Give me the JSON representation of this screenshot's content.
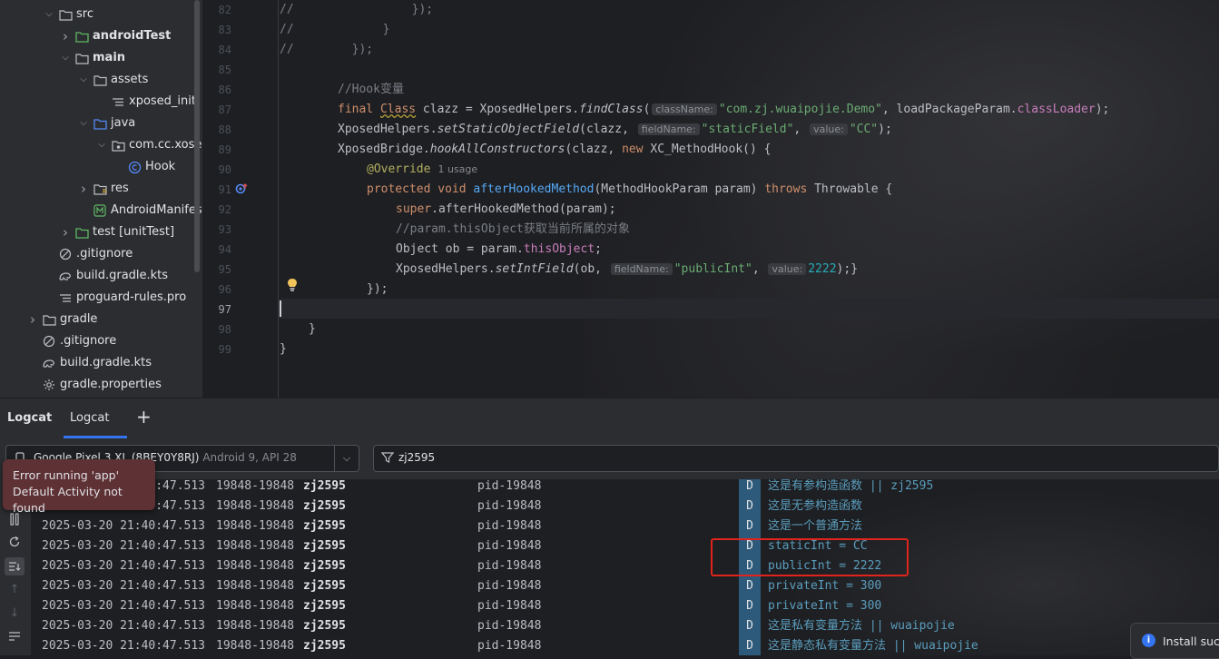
{
  "project_tree": {
    "items": [
      {
        "label": "src",
        "icon": "folder-icon",
        "indent": 1,
        "chevron": "v",
        "bold": false
      },
      {
        "label": "androidTest",
        "icon": "test-folder-icon",
        "indent": 2,
        "chevron": ">",
        "bold": true
      },
      {
        "label": "main",
        "icon": "folder-icon",
        "indent": 2,
        "chevron": "v",
        "bold": true
      },
      {
        "label": "assets",
        "icon": "folder-icon",
        "indent": 3,
        "chevron": "v",
        "bold": false
      },
      {
        "label": "xposed_init",
        "icon": "text-file-icon",
        "indent": 4,
        "chevron": "",
        "bold": false
      },
      {
        "label": "java",
        "icon": "source-folder-icon",
        "indent": 3,
        "chevron": "v",
        "bold": false
      },
      {
        "label": "com.cc.xosed",
        "icon": "package-icon",
        "indent": 4,
        "chevron": "v",
        "bold": false
      },
      {
        "label": "Hook",
        "icon": "class-icon",
        "indent": 5,
        "chevron": "",
        "bold": false
      },
      {
        "label": "res",
        "icon": "resource-folder-icon",
        "indent": 3,
        "chevron": ">",
        "bold": false
      },
      {
        "label": "AndroidManifest",
        "icon": "manifest-icon",
        "indent": 3,
        "chevron": "",
        "bold": false
      },
      {
        "label": "test [unitTest]",
        "icon": "test-folder-icon",
        "indent": 2,
        "chevron": ">",
        "bold": false
      },
      {
        "label": ".gitignore",
        "icon": "gitignore-icon",
        "indent": 1,
        "chevron": "",
        "bold": false
      },
      {
        "label": "build.gradle.kts",
        "icon": "gradle-icon",
        "indent": 1,
        "chevron": "",
        "bold": false
      },
      {
        "label": "proguard-rules.pro",
        "icon": "text-file-icon",
        "indent": 1,
        "chevron": "",
        "bold": false
      },
      {
        "label": "gradle",
        "icon": "folder-icon",
        "indent": 0,
        "chevron": ">",
        "bold": false
      },
      {
        "label": ".gitignore",
        "icon": "gitignore-icon",
        "indent": 0,
        "chevron": "",
        "bold": false
      },
      {
        "label": "build.gradle.kts",
        "icon": "gradle-icon",
        "indent": 0,
        "chevron": "",
        "bold": false
      },
      {
        "label": "gradle.properties",
        "icon": "settings-icon",
        "indent": 0,
        "chevron": "",
        "bold": false
      }
    ]
  },
  "editor": {
    "line_numbers": [
      "82",
      "83",
      "84",
      "85",
      "86",
      "87",
      "88",
      "89",
      "90",
      "91",
      "92",
      "93",
      "94",
      "95",
      "96",
      "97",
      "98",
      "99"
    ],
    "code": {
      "l82": [
        "//",
        "});"
      ],
      "l83": [
        "//",
        "}"
      ],
      "l84": [
        "//",
        "});"
      ],
      "l86": "//Hook变量",
      "l87": {
        "kw": "final ",
        "type": "Class",
        "rest1": " clazz = XposedHelpers.",
        "call": "findClass",
        "hint1": "className:",
        "s1": "\"com.zj.wuaipojie.Demo\"",
        "rest2": ", loadPackageParam.",
        "fld": "classLoader",
        "end": ");"
      },
      "l88": {
        "pre": "XposedHelpers.",
        "call": "setStaticObjectField",
        "rest1": "(clazz, ",
        "hint1": "fieldName:",
        "s1": "\"staticField\"",
        "sep": ", ",
        "hint2": "value:",
        "s2": "\"CC\"",
        "end": ");"
      },
      "l89": {
        "pre": "XposedBridge.",
        "call": "hookAllConstructors",
        "rest1": "(clazz, ",
        "kw": "new",
        "rest2": " XC_MethodHook() {"
      },
      "l90": {
        "ann": "@Override",
        "usage": "1 usage"
      },
      "l91": {
        "kw": "protected void ",
        "fn": "afterHookedMethod",
        "rest1": "(MethodHookParam param) ",
        "kw2": "throws",
        "rest2": " Throwable {"
      },
      "l92": {
        "kw": "super",
        "rest": ".afterHookedMethod(param);"
      },
      "l93": "//param.thisObject获取当前所属的对象",
      "l94": {
        "pre": "Object ob = param.",
        "fld": "thisObject",
        "end": ";"
      },
      "l95": {
        "pre": "XposedHelpers.",
        "call": "setIntField",
        "rest1": "(ob, ",
        "hint1": "fieldName:",
        "s1": "\"publicInt\"",
        "sep": ", ",
        "hint2": "value:",
        "num": "2222",
        "end": ");}"
      },
      "l96": "});",
      "l98": "}",
      "l99": "}"
    }
  },
  "logcat": {
    "tabs": [
      "Logcat",
      "Logcat"
    ],
    "add_tab": "+",
    "device": {
      "name": "Google Pixel 3 XL (8BEY0Y8RJ)",
      "detail": " Android 9, API 28"
    },
    "filter": "zj2595",
    "error_popup": {
      "line1": "Error running 'app'",
      "line2": "Default Activity not found"
    },
    "rows": [
      {
        "date": "2025-03-20 21:40:47.513",
        "pid": "19848-19848",
        "tag": "zj2595",
        "proc": "pid-19848",
        "level": "D",
        "msg": "这是有参构造函数 || zj2595"
      },
      {
        "date": "2025-03-20 21:40:47.513",
        "pid": "19848-19848",
        "tag": "zj2595",
        "proc": "pid-19848",
        "level": "D",
        "msg": "这是无参构造函数"
      },
      {
        "date": "2025-03-20 21:40:47.513",
        "pid": "19848-19848",
        "tag": "zj2595",
        "proc": "pid-19848",
        "level": "D",
        "msg": "这是一个普通方法"
      },
      {
        "date": "2025-03-20 21:40:47.513",
        "pid": "19848-19848",
        "tag": "zj2595",
        "proc": "pid-19848",
        "level": "D",
        "msg": "staticInt = CC"
      },
      {
        "date": "2025-03-20 21:40:47.513",
        "pid": "19848-19848",
        "tag": "zj2595",
        "proc": "pid-19848",
        "level": "D",
        "msg": "publicInt = 2222"
      },
      {
        "date": "2025-03-20 21:40:47.513",
        "pid": "19848-19848",
        "tag": "zj2595",
        "proc": "pid-19848",
        "level": "D",
        "msg": "privateInt = 300"
      },
      {
        "date": "2025-03-20 21:40:47.513",
        "pid": "19848-19848",
        "tag": "zj2595",
        "proc": "pid-19848",
        "level": "D",
        "msg": "privateInt = 300"
      },
      {
        "date": "2025-03-20 21:40:47.513",
        "pid": "19848-19848",
        "tag": "zj2595",
        "proc": "pid-19848",
        "level": "D",
        "msg": "这是私有变量方法 || wuaipojie"
      },
      {
        "date": "2025-03-20 21:40:47.513",
        "pid": "19848-19848",
        "tag": "zj2595",
        "proc": "pid-19848",
        "level": "D",
        "msg": "这是静态私有变量方法 || wuaipojie"
      }
    ],
    "install_toast": "Install succ"
  },
  "colors": {
    "accent": "#3574f0",
    "error_bg": "#5e3134",
    "highlight_box": "#e0241c",
    "log_level_bg": "#2d5a7a"
  }
}
